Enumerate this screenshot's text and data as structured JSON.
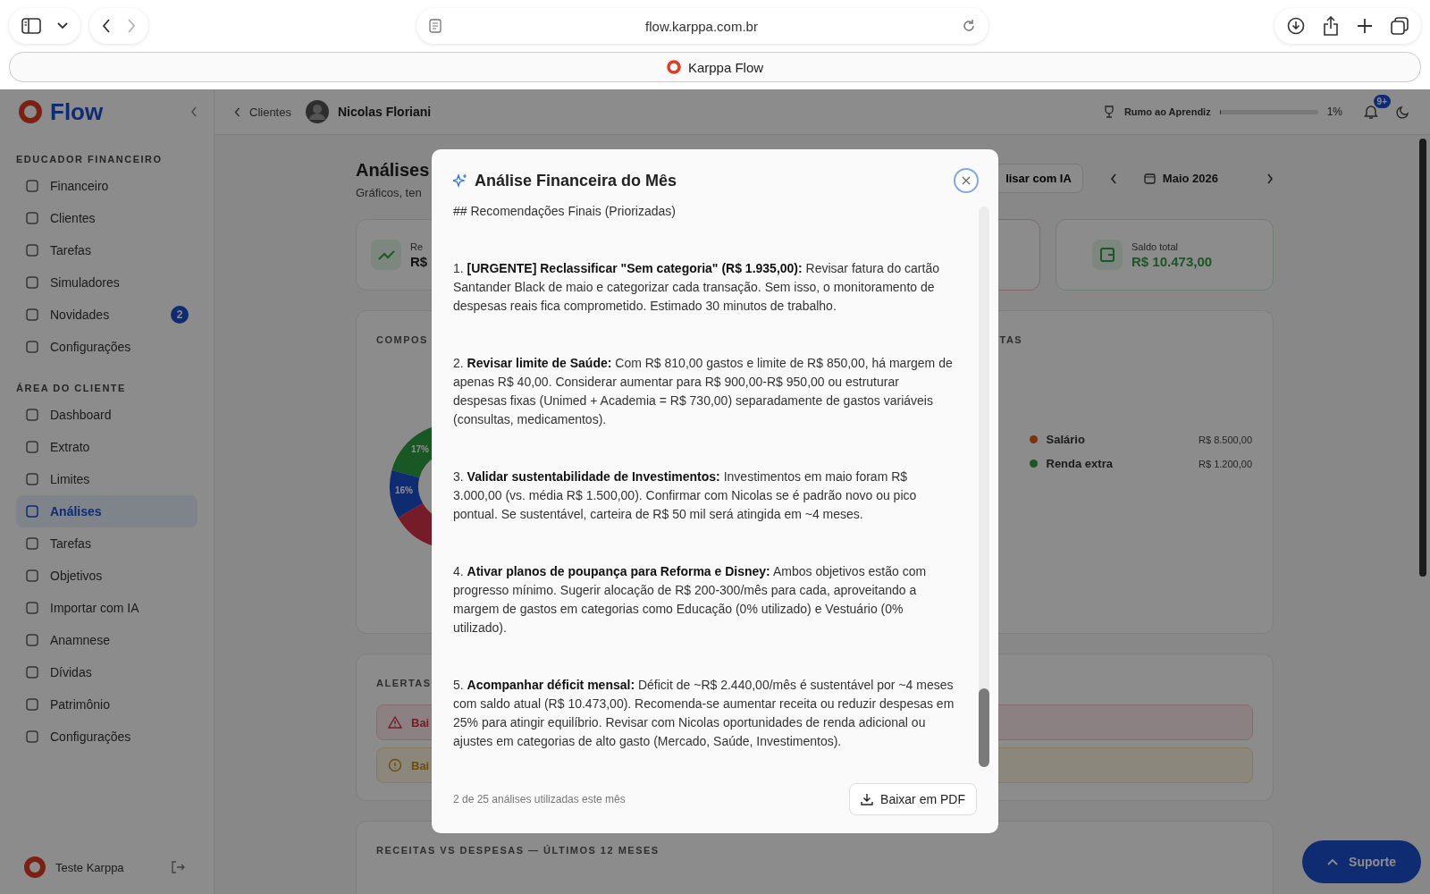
{
  "browser": {
    "url": "flow.karppa.com.br",
    "forward_disabled": true,
    "tab": {
      "title": "Karppa Flow"
    }
  },
  "sidebar": {
    "logo": "Flow",
    "sections": [
      {
        "title": "EDUCADOR FINANCEIRO",
        "items": [
          {
            "label": "Financeiro",
            "selected": false
          },
          {
            "label": "Clientes",
            "selected": false
          },
          {
            "label": "Tarefas",
            "selected": false
          },
          {
            "label": "Simuladores",
            "selected": false
          },
          {
            "label": "Novidades",
            "selected": false,
            "badge": "2"
          },
          {
            "label": "Configurações",
            "selected": false
          }
        ]
      },
      {
        "title": "ÁREA DO CLIENTE",
        "items": [
          {
            "label": "Dashboard",
            "selected": false
          },
          {
            "label": "Extrato",
            "selected": false
          },
          {
            "label": "Limites",
            "selected": false
          },
          {
            "label": "Análises",
            "selected": true
          },
          {
            "label": "Tarefas",
            "selected": false
          },
          {
            "label": "Objetivos",
            "selected": false
          },
          {
            "label": "Importar com IA",
            "selected": false
          },
          {
            "label": "Anamnese",
            "selected": false
          },
          {
            "label": "Dívidas",
            "selected": false
          },
          {
            "label": "Patrimônio",
            "selected": false
          },
          {
            "label": "Configurações",
            "selected": false
          }
        ]
      }
    ],
    "user": {
      "name": "Teste Karppa"
    }
  },
  "header": {
    "back_link": "Clientes",
    "client_name": "Nicolas Floriani",
    "progress": {
      "label": "Rumo ao Aprendiz",
      "level": 0.01,
      "reading": "1%"
    },
    "notification_badge": "9+"
  },
  "page": {
    "title": "Análises",
    "subtitle": "Gráficos, ten",
    "ai_button": "lisar com IA",
    "month": "Maio 2026",
    "first_card": {
      "label": "Re",
      "value": "R$"
    },
    "balance_card": {
      "label": "Saldo total",
      "value": "R$ 10.473,00"
    },
    "composition": {
      "title": "COMPOS",
      "donut_labels": [
        "17%",
        "16%"
      ],
      "right_title": "TAS",
      "legend": [
        {
          "label": "Salário",
          "value": "R$ 8.500,00",
          "color": "#803107"
        },
        {
          "label": "Renda extra",
          "value": "R$ 1.200,00",
          "color": "#1a5725"
        }
      ]
    },
    "alerts": {
      "title": "ALERTAS",
      "items": [
        {
          "kind": "danger",
          "text": "Bai"
        },
        {
          "kind": "warning",
          "text": "Bai"
        }
      ]
    },
    "chart_title": "RECEITAS VS DESPESAS — ÚLTIMOS 12 MESES",
    "support_button": "Suporte"
  },
  "modal": {
    "title": "Análise Financeira do Mês",
    "heading": "## Recomendações Finais (Priorizadas)",
    "paragraphs": [
      "1. **[URGENTE] Reclassificar \"Sem categoria\" (R$ 1.935,00):** Revisar fatura do cartão Santander Black de maio e categorizar cada transação. Sem isso, o monitoramento de despesas reais fica comprometido. Estimado 30 minutos de trabalho.",
      "2. **Revisar limite de Saúde:** Com R$ 810,00 gastos e limite de R$ 850,00, há margem de apenas R$ 40,00. Considerar aumentar para R$ 900,00-R$ 950,00 ou estruturar despesas fixas (Unimed + Academia = R$ 730,00) separadamente de gastos variáveis (consultas, medicamentos).",
      "3. **Validar sustentabilidade de Investimentos:** Investimentos em maio foram R$ 3.000,00 (vs. média R$ 1.500,00). Confirmar com Nicolas se é padrão novo ou pico pontual. Se sustentável, carteira de R$ 50 mil será atingida em ~4 meses.",
      "4. **Ativar planos de poupança para Reforma e Disney:** Ambos objetivos estão com progresso mínimo. Sugerir alocação de R$ 200-300/mês para cada, aproveitando a margem de gastos em categorias como Educação (0% utilizado) e Vestuário (0% utilizado).",
      "5. **Acompanhar déficit mensal:** Déficit de ~R$ 2.440,00/mês é sustentável por ~4 meses com saldo atual (R$ 10.473,00). Recomenda-se aumentar receita ou reduzir despesas em 25% para atingir equilíbrio. Revisar com Nicolas oportunidades de renda adicional ou ajustes em categorias de alto gasto (Mercado, Saúde, Investimentos)."
    ],
    "usage": "2 de 25 análises utilizadas este mês",
    "download_button": "Baixar em PDF"
  }
}
